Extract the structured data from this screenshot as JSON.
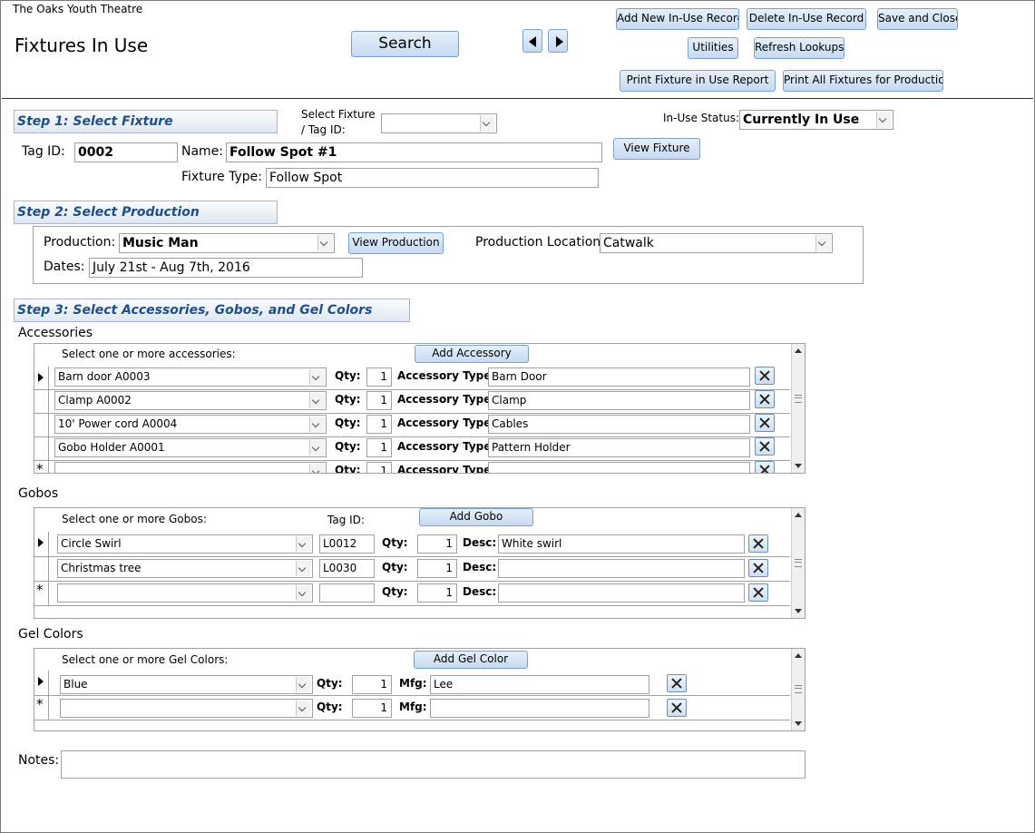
{
  "app": {
    "org_name": "The Oaks Youth Theatre",
    "form_title": "Fixtures In Use"
  },
  "toolbar": {
    "search_label": "Search",
    "add_new_label": "Add New In-Use Record",
    "delete_label": "Delete In-Use Record",
    "save_close_label": "Save and Close",
    "utilities_label": "Utilities",
    "refresh_label": "Refresh Lookups",
    "print_fixture_label": "Print Fixture in Use Report",
    "print_all_label": "Print All Fixtures for Production"
  },
  "step1": {
    "heading": "Step 1:  Select Fixture",
    "select_label_line1": "Select Fixture",
    "select_label_line2": "/ Tag ID:",
    "select_value": "",
    "status_label": "In-Use Status:",
    "status_value": "Currently In Use",
    "tag_label": "Tag ID:",
    "tag_value": "0002",
    "name_label": "Name:",
    "name_value": "Follow Spot #1",
    "type_label": "Fixture Type:",
    "type_value": "Follow Spot",
    "view_label": "View Fixture"
  },
  "step2": {
    "heading": "Step 2:  Select Production",
    "production_label": "Production:",
    "production_value": "Music Man",
    "view_label": "View Production",
    "location_label": "Production Location",
    "location_value": "Catwalk",
    "dates_label": "Dates:",
    "dates_value": "July 21st - Aug 7th, 2016"
  },
  "step3": {
    "heading": "Step 3:  Select Accessories, Gobos, and Gel Colors"
  },
  "accessories": {
    "section_label": "Accessories",
    "header": "Select one or more accessories:",
    "add_label": "Add Accessory",
    "qty_label": "Qty:",
    "type_label": "Accessory Type:",
    "rows": [
      {
        "item": "Barn door A0003",
        "qty": "1",
        "type": "Barn Door"
      },
      {
        "item": "Clamp A0002",
        "qty": "1",
        "type": "Clamp"
      },
      {
        "item": "10' Power cord A0004",
        "qty": "1",
        "type": "Cables"
      },
      {
        "item": "Gobo Holder A0001",
        "qty": "1",
        "type": "Pattern Holder"
      },
      {
        "item": "",
        "qty": "1",
        "type": ""
      }
    ]
  },
  "gobos": {
    "section_label": "Gobos",
    "header": "Select one or more Gobos:",
    "tag_header": "Tag ID:",
    "add_label": "Add Gobo",
    "qty_label": "Qty:",
    "desc_label": "Desc:",
    "rows": [
      {
        "item": "Circle Swirl",
        "tag": "L0012",
        "qty": "1",
        "desc": "White swirl"
      },
      {
        "item": "Christmas tree",
        "tag": "L0030",
        "qty": "1",
        "desc": ""
      },
      {
        "item": "",
        "tag": "",
        "qty": "1",
        "desc": ""
      }
    ]
  },
  "gels": {
    "section_label": "Gel Colors",
    "header": "Select one or more Gel Colors:",
    "add_label": "Add Gel Color",
    "qty_label": "Qty:",
    "mfg_label": "Mfg:",
    "rows": [
      {
        "item": "Blue",
        "qty": "1",
        "mfg": "Lee"
      },
      {
        "item": "",
        "qty": "1",
        "mfg": ""
      }
    ]
  },
  "notes": {
    "label": "Notes:",
    "value": ""
  },
  "colors": {
    "step_heading": "#1f4e8c",
    "button_top": "#e6f0fb",
    "button_bottom": "#c6daf1"
  }
}
